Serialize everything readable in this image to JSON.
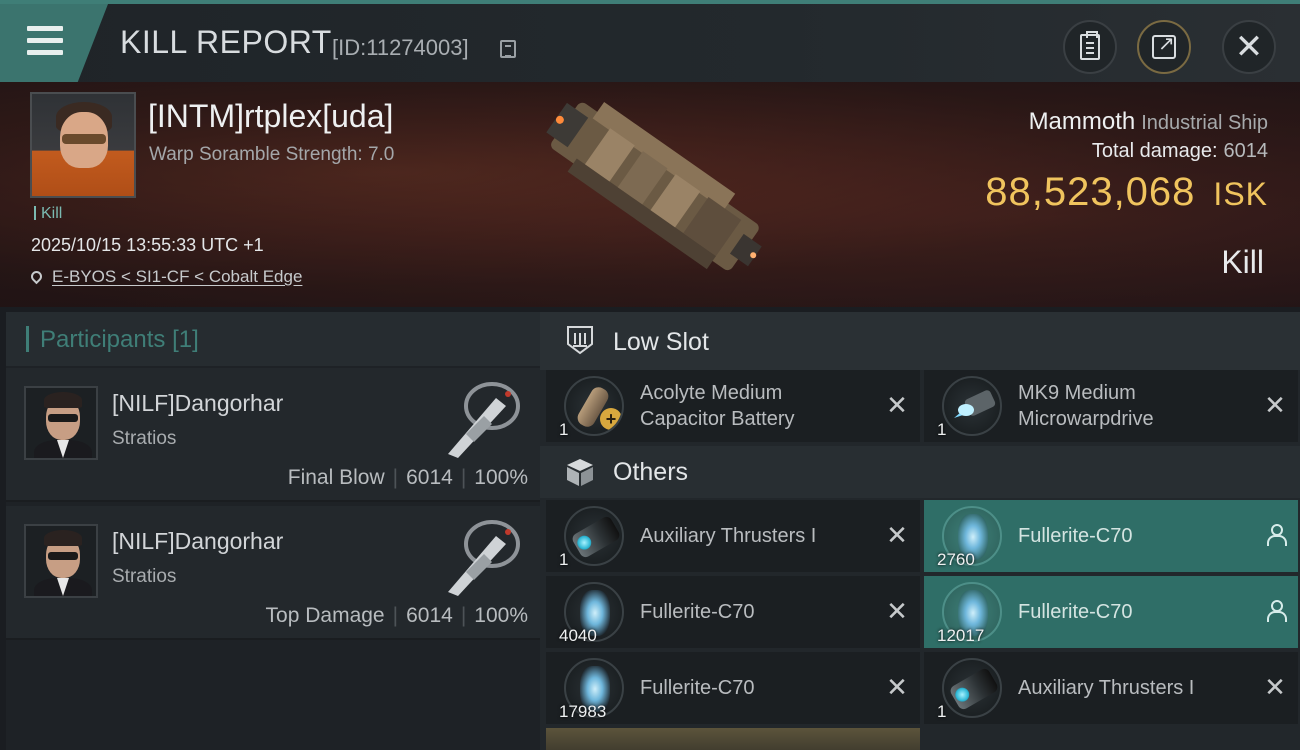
{
  "header": {
    "title": "KILL REPORT",
    "report_id": "[ID:11274003]",
    "close_glyph": "✕"
  },
  "victim": {
    "pilot_name": "[INTM]rtplex[uda]",
    "scramble": "Warp Soramble Strength: 7.0",
    "tag": "Kill",
    "timestamp": "2025/10/15 13:55:33 UTC +1",
    "location": "E-BYOS < SI1-CF < Cobalt Edge",
    "ship_name": "Mammoth",
    "ship_class": "Industrial Ship",
    "total_damage_label": "Total damage:",
    "total_damage": "6014",
    "isk_value": "88,523,068",
    "isk_unit": "ISK",
    "kill_type": "Kill"
  },
  "participants": {
    "title": "Participants",
    "count": "[1]",
    "list": [
      {
        "name": "[NILF]Dangorhar",
        "ship": "Stratios",
        "role": "Final Blow",
        "damage": "6014",
        "percent": "100%"
      },
      {
        "name": "[NILF]Dangorhar",
        "ship": "Stratios",
        "role": "Top Damage",
        "damage": "6014",
        "percent": "100%"
      }
    ]
  },
  "sections": {
    "low_slot": "Low Slot",
    "others": "Others"
  },
  "low_slot_items": [
    {
      "name_line1": "Acolyte Medium",
      "name_line2": "Capacitor Battery",
      "qty": "1",
      "icon": "capacitor-battery-icon",
      "status": "destroyed"
    },
    {
      "name_line1": "MK9 Medium",
      "name_line2": "Microwarpdrive",
      "qty": "1",
      "icon": "microwarpdrive-icon",
      "status": "destroyed"
    }
  ],
  "other_items": [
    {
      "name": "Auxiliary Thrusters I",
      "qty": "1",
      "icon": "thruster-icon",
      "status": "destroyed"
    },
    {
      "name": "Fullerite-C70",
      "qty": "2760",
      "icon": "fullerite-icon",
      "status": "dropped"
    },
    {
      "name": "Fullerite-C70",
      "qty": "4040",
      "icon": "fullerite-icon",
      "status": "destroyed"
    },
    {
      "name": "Fullerite-C70",
      "qty": "12017",
      "icon": "fullerite-icon",
      "status": "dropped"
    },
    {
      "name": "Fullerite-C70",
      "qty": "17983",
      "icon": "fullerite-icon",
      "status": "destroyed"
    },
    {
      "name": "Auxiliary Thrusters I",
      "qty": "1",
      "icon": "thruster-icon",
      "status": "destroyed"
    }
  ],
  "glyphs": {
    "destroyed": "✕"
  },
  "colors": {
    "accent_teal": "#3f7e77",
    "dropped_bg": "#2f6e67",
    "isk_gold": "#f0c45e"
  }
}
